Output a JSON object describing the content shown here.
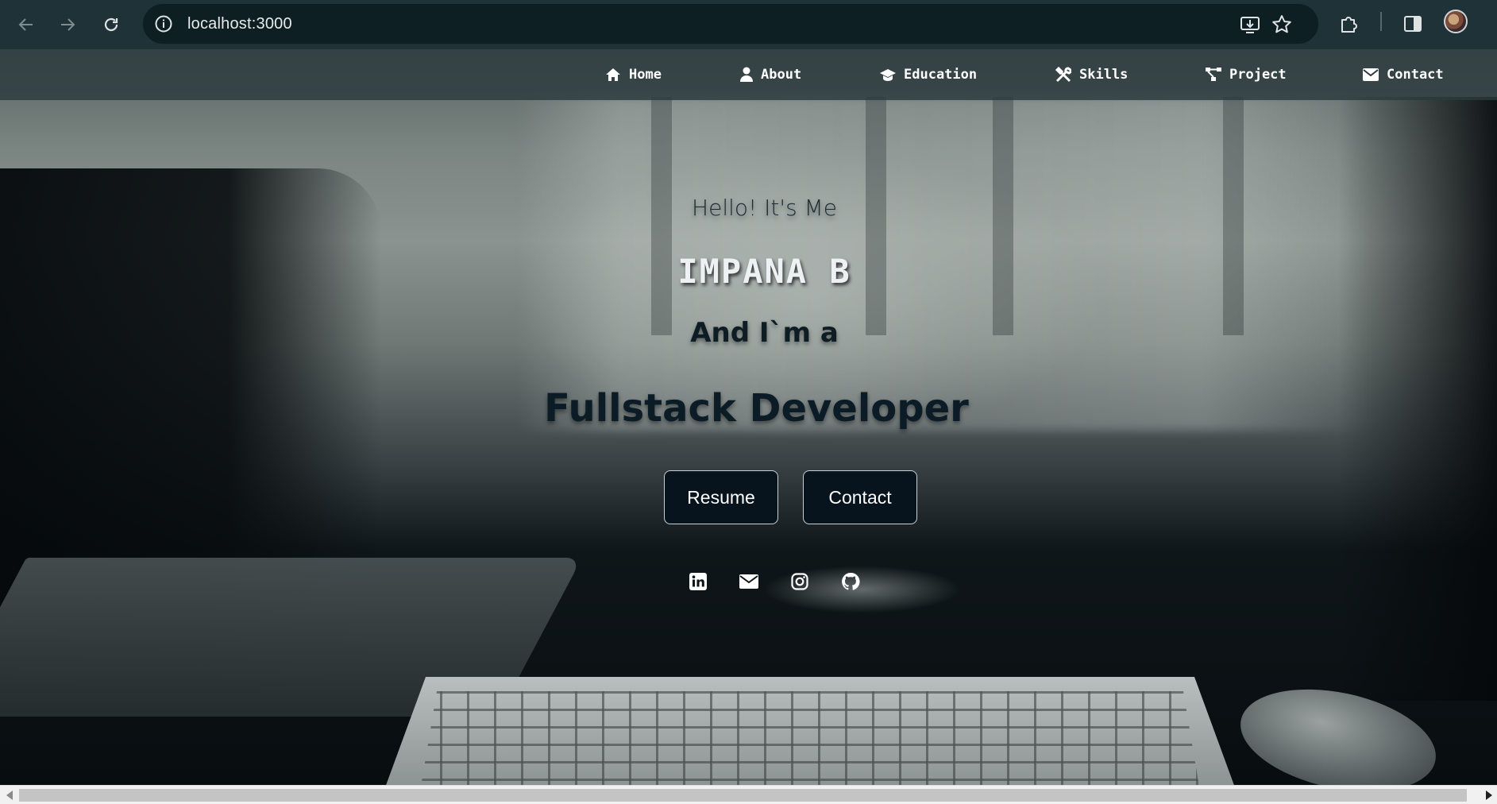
{
  "browser": {
    "url": "localhost:3000",
    "icons": [
      "back-arrow-icon",
      "forward-arrow-icon",
      "reload-icon",
      "site-info-icon",
      "install-app-icon",
      "bookmark-star-icon",
      "extensions-puzzle-icon",
      "side-panel-icon",
      "profile-avatar"
    ]
  },
  "nav": {
    "items": [
      {
        "label": "Home",
        "icon": "home-icon"
      },
      {
        "label": "About",
        "icon": "user-icon"
      },
      {
        "label": "Education",
        "icon": "graduation-cap-icon"
      },
      {
        "label": "Skills",
        "icon": "tools-icon"
      },
      {
        "label": "Project",
        "icon": "project-diagram-icon"
      },
      {
        "label": "Contact",
        "icon": "envelope-icon"
      }
    ]
  },
  "hero": {
    "greeting": "Hello! It's Me",
    "name": "IMPANA B",
    "subtitle": "And I`m a",
    "role": "Fullstack Developer",
    "buttons": {
      "resume": "Resume",
      "contact": "Contact"
    },
    "socials": [
      "linkedin-icon",
      "email-icon",
      "instagram-icon",
      "github-icon"
    ]
  },
  "colors": {
    "chrome_bg": "#1f3237",
    "omnibox_bg": "#0e1f23",
    "nav_bg": "#2c3a3e",
    "button_bg": "#07141d",
    "role_text": "#0b1c26"
  }
}
